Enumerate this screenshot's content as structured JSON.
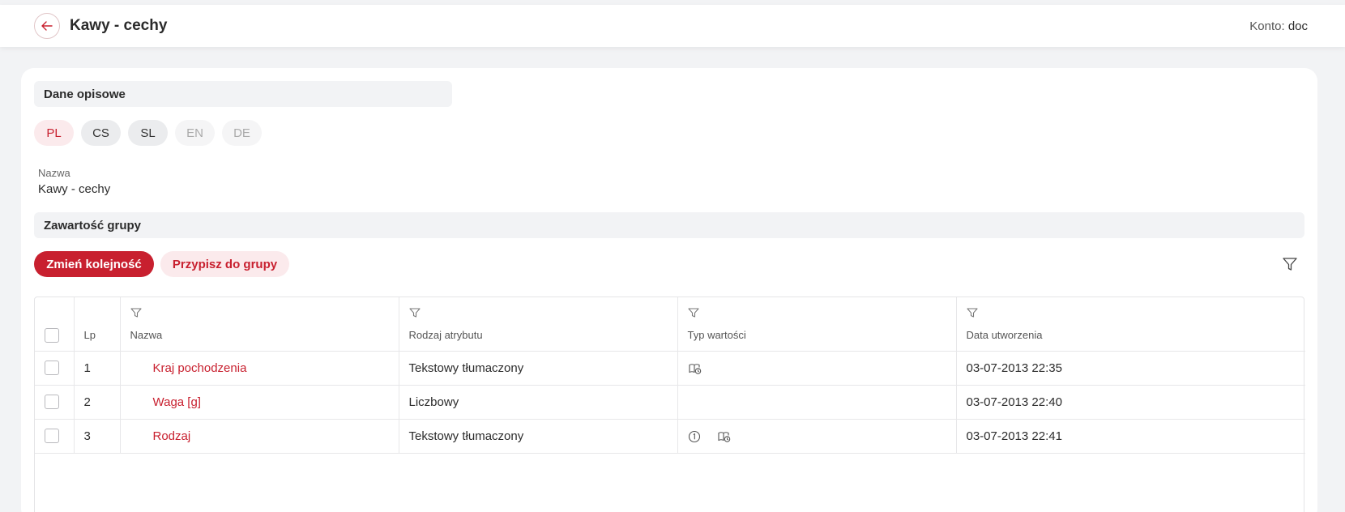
{
  "header": {
    "title": "Kawy - cechy",
    "account_label": "Konto:",
    "account_value": "doc"
  },
  "descriptive": {
    "section_title": "Dane opisowe",
    "languages": [
      {
        "code": "PL",
        "state": "active"
      },
      {
        "code": "CS",
        "state": "normal"
      },
      {
        "code": "SL",
        "state": "normal"
      },
      {
        "code": "EN",
        "state": "muted"
      },
      {
        "code": "DE",
        "state": "muted"
      }
    ],
    "name_label": "Nazwa",
    "name_value": "Kawy - cechy"
  },
  "group": {
    "section_title": "Zawartość grupy",
    "reorder_label": "Zmień kolejność",
    "assign_label": "Przypisz do grupy"
  },
  "table": {
    "columns": [
      "Lp",
      "Nazwa",
      "Rodzaj atrybutu",
      "Typ wartości",
      "Data utworzenia"
    ],
    "rows": [
      {
        "lp": "1",
        "name": "Kraj pochodzenia",
        "attr_type": "Tekstowy tłumaczony",
        "value_icons": [
          "translated-dictionary-icon"
        ],
        "created": "03-07-2013 22:35"
      },
      {
        "lp": "2",
        "name": "Waga [g]",
        "attr_type": "Liczbowy",
        "value_icons": [],
        "created": "03-07-2013 22:40"
      },
      {
        "lp": "3",
        "name": "Rodzaj",
        "attr_type": "Tekstowy tłumaczony",
        "value_icons": [
          "single-value-icon",
          "translated-dictionary-icon"
        ],
        "created": "03-07-2013 22:41"
      }
    ]
  },
  "colors": {
    "accent": "#c8202f",
    "accent_light": "#fbeaec",
    "background": "#f2f3f5"
  }
}
